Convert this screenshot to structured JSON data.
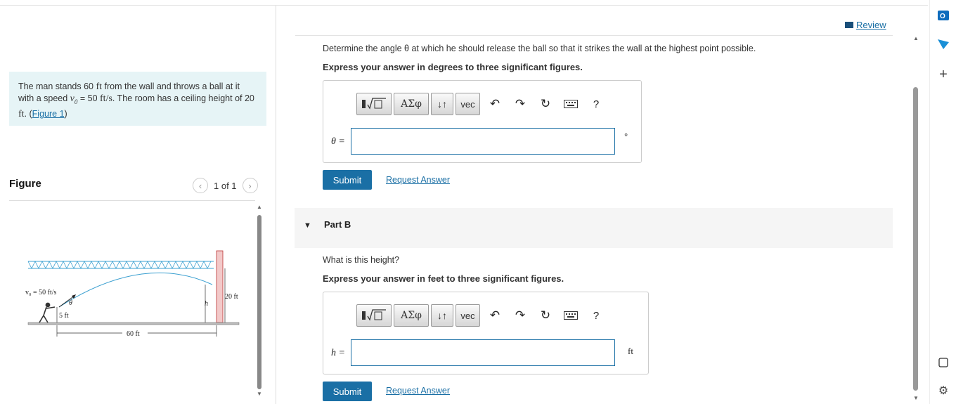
{
  "problem": {
    "text_a": "The man stands 60 ",
    "unit_ft": "ft",
    "text_b": " from the wall and throws a ball at it with a speed ",
    "v0": "v",
    "v0_sub": "0",
    "text_c": " = 50 ",
    "unit_fts": "ft/s",
    "text_d": ". The room has a ceiling height of 20 ",
    "text_e": ". (",
    "link": "Figure 1",
    "text_f": ")"
  },
  "figure": {
    "title": "Figure",
    "pager": "1 of 1",
    "labels": {
      "v0": "v₀ = 50 ft/s",
      "theta": "θ",
      "h": "h",
      "five_ft": "5 ft",
      "twenty_ft": "20 ft",
      "sixty_ft": "60 ft"
    }
  },
  "header": {
    "review": "Review"
  },
  "partA": {
    "question": "Determine the angle θ at which he should release the ball so that it strikes the wall at the highest point possible.",
    "instruction": "Express your answer in degrees to three significant figures.",
    "lhs": "θ =",
    "unit": "°",
    "submit": "Submit",
    "request": "Request Answer"
  },
  "partB": {
    "label": "Part B",
    "question": "What is this height?",
    "instruction": "Express your answer in feet to three significant figures.",
    "lhs": "h =",
    "unit": "ft",
    "submit": "Submit",
    "request": "Request Answer"
  },
  "toolbar": {
    "greek": "ΑΣφ",
    "arrows": "↓↑",
    "vec": "vec",
    "help": "?"
  }
}
